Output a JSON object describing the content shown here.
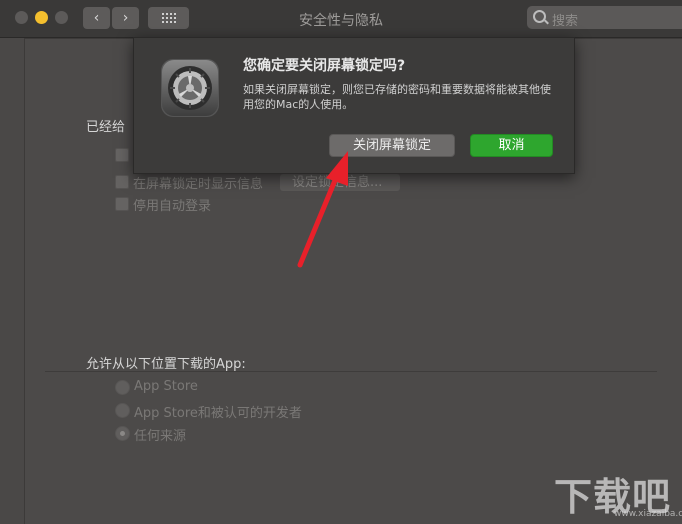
{
  "window": {
    "title": "安全性与隐私",
    "nav_back": "‹",
    "nav_forward": "›"
  },
  "search": {
    "placeholder": "搜索"
  },
  "content": {
    "section_label": "已经给",
    "options": {
      "lock_message": "在屏幕锁定时显示信息",
      "set_lock_message_button": "设定锁定信息...",
      "disable_auto_login": "停用自动登录"
    },
    "downloads_label": "允许从以下位置下载的App:",
    "download_sources": [
      {
        "label": "App Store",
        "selected": false
      },
      {
        "label": "App Store和被认可的开发者",
        "selected": false
      },
      {
        "label": "任何来源",
        "selected": true
      }
    ]
  },
  "dialog": {
    "icon": "system-preferences-gear-icon",
    "title": "您确定要关闭屏幕锁定吗?",
    "message": "如果关闭屏幕锁定，则您已存储的密码和重要数据将能被其他使用您的Mac的人使用。",
    "confirm_label": "关闭屏幕锁定",
    "cancel_label": "取消"
  },
  "annotation": {
    "color": "#e8202a"
  },
  "watermark": {
    "text": "下载吧",
    "url": "www.xiazaiba.com"
  },
  "colors": {
    "window_bg": "#4a4847",
    "cancel_accent": "#2ea62e",
    "minimize_yellow": "#f4bf2e"
  }
}
